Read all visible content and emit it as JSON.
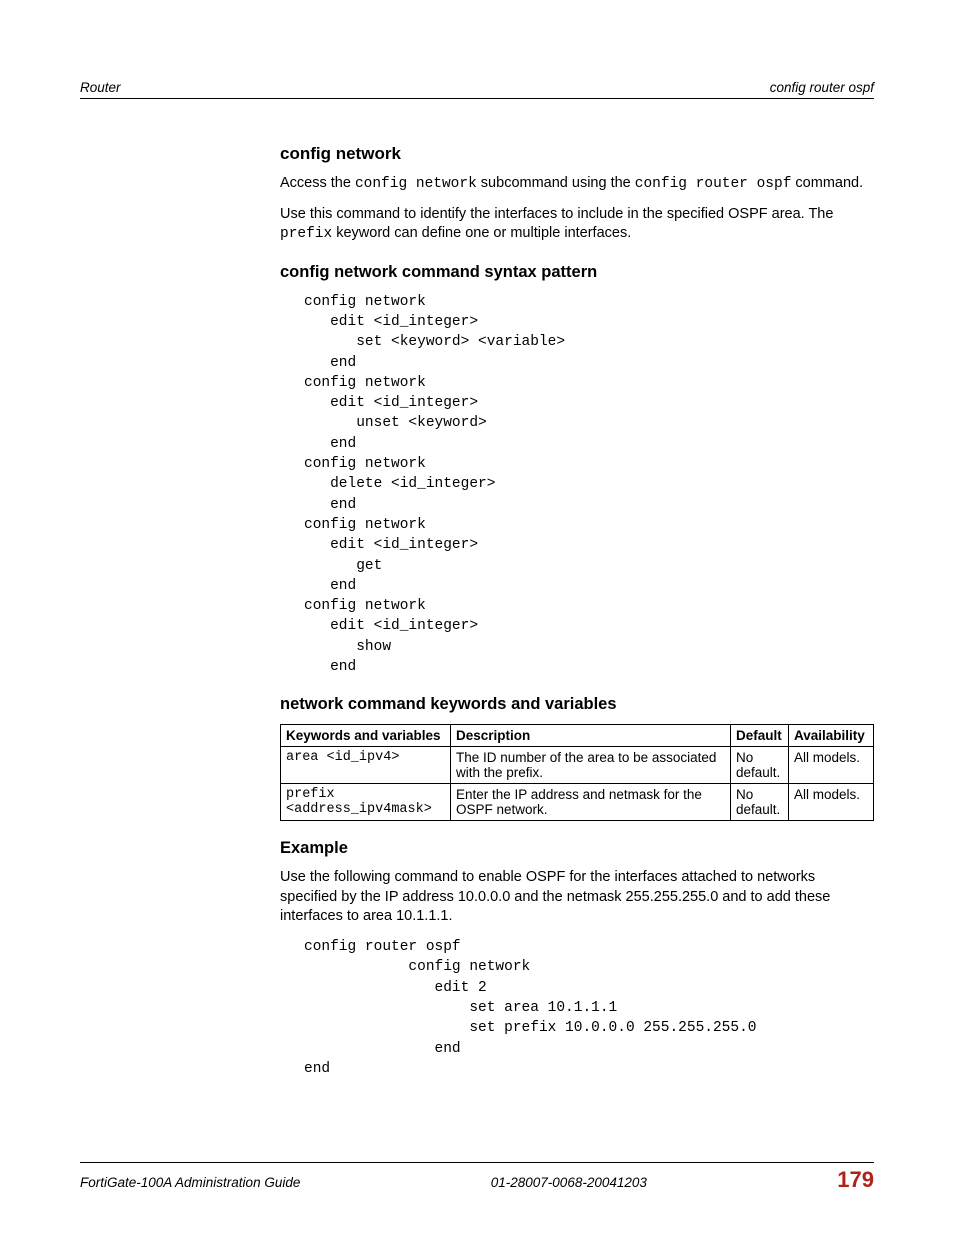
{
  "header": {
    "left": "Router",
    "right": "config router ospf"
  },
  "s1": {
    "title": "config network",
    "p1_a": "Access the ",
    "p1_b": "config network",
    "p1_c": " subcommand using the ",
    "p1_d": "config router ospf",
    "p1_e": " command.",
    "p2_a": "Use this command to identify the interfaces to include in the specified OSPF area. The ",
    "p2_b": "prefix",
    "p2_c": " keyword can define one or multiple interfaces."
  },
  "s2": {
    "title": "config network command syntax pattern",
    "code": "config network\n   edit <id_integer>\n      set <keyword> <variable>\n   end\nconfig network\n   edit <id_integer>\n      unset <keyword>\n   end\nconfig network\n   delete <id_integer>\n   end\nconfig network\n   edit <id_integer>\n      get\n   end\nconfig network\n   edit <id_integer>\n      show\n   end"
  },
  "s3": {
    "title": "network command keywords and variables",
    "cols": [
      "Keywords and variables",
      "Description",
      "Default",
      "Availability"
    ],
    "rows": [
      {
        "kw": "area <id_ipv4>",
        "desc": "The ID number of the area to be associated with the prefix.",
        "def": "No default.",
        "av": "All models."
      },
      {
        "kw": "prefix\n<address_ipv4mask>",
        "desc": "Enter the IP address and netmask for the OSPF network.",
        "def": "No default.",
        "av": "All models."
      }
    ]
  },
  "s4": {
    "title": "Example",
    "p1": "Use the following command to enable OSPF for the interfaces attached to networks specified by the IP address 10.0.0.0 and the netmask 255.255.255.0 and to add these interfaces to area 10.1.1.1.",
    "code": "config router ospf\n            config network\n               edit 2\n                   set area 10.1.1.1\n                   set prefix 10.0.0.0 255.255.255.0\n               end\nend"
  },
  "footer": {
    "left": "FortiGate-100A Administration Guide",
    "center": "01-28007-0068-20041203",
    "right": "179"
  }
}
